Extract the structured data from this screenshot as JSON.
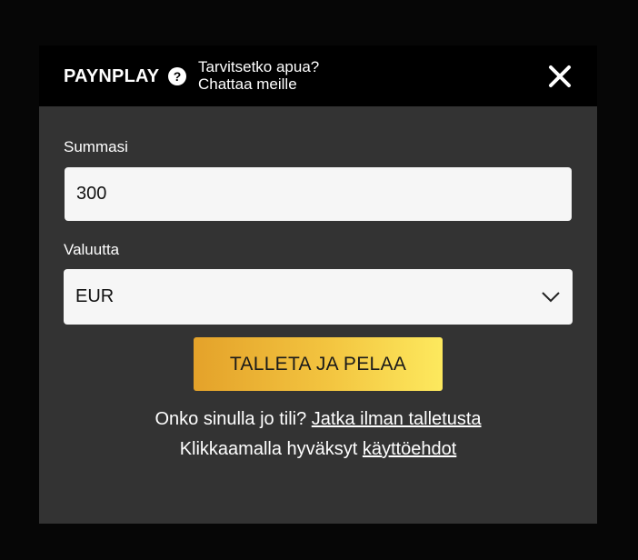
{
  "header": {
    "brand": "PAYNPLAY",
    "help_icon": "question-circle-icon",
    "help_line1": "Tarvitsetko apua?",
    "help_line2": "Chattaa meille",
    "close_icon": "close-icon"
  },
  "form": {
    "amount_label": "Summasi",
    "amount_value": "300",
    "currency_label": "Valuutta",
    "currency_value": "EUR",
    "currency_icon": "chevron-down-icon",
    "submit_label": "TALLETA JA PELAA"
  },
  "footer": {
    "account_text": "Onko sinulla jo tili?",
    "account_link": "Jatka ilman talletusta",
    "terms_text": "Klikkaamalla hyväksyt",
    "terms_link": "käyttöehdot"
  },
  "colors": {
    "overlay": "#060606",
    "header_bg": "#000000",
    "modal_bg": "#333333",
    "input_bg": "#f6f6f6",
    "cta_gradient_start": "#e4a22a",
    "cta_gradient_end": "#fde95e"
  }
}
